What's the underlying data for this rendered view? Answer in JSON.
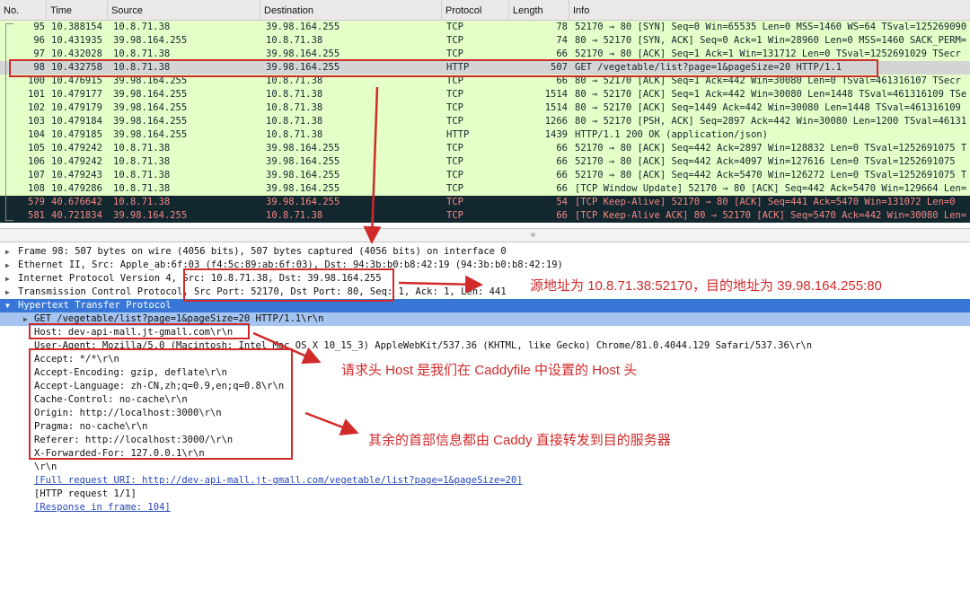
{
  "columns": [
    "No.",
    "Time",
    "Source",
    "Destination",
    "Protocol",
    "Length",
    "Info"
  ],
  "packets": [
    {
      "no": "95",
      "time": "10.388154",
      "src": "10.8.71.38",
      "dst": "39.98.164.255",
      "proto": "TCP",
      "len": "78",
      "info": "52170 → 80 [SYN] Seq=0 Win=65535 Len=0 MSS=1460 WS=64 TSval=125269090",
      "style": "tcp"
    },
    {
      "no": "96",
      "time": "10.431935",
      "src": "39.98.164.255",
      "dst": "10.8.71.38",
      "proto": "TCP",
      "len": "74",
      "info": "80 → 52170 [SYN, ACK] Seq=0 Ack=1 Win=28960 Len=0 MSS=1460 SACK_PERM=",
      "style": "tcp"
    },
    {
      "no": "97",
      "time": "10.432028",
      "src": "10.8.71.38",
      "dst": "39.98.164.255",
      "proto": "TCP",
      "len": "66",
      "info": "52170 → 80 [ACK] Seq=1 Ack=1 Win=131712 Len=0 TSval=1252691029 TSecr",
      "style": "tcp"
    },
    {
      "no": "98",
      "time": "10.432758",
      "src": "10.8.71.38",
      "dst": "39.98.164.255",
      "proto": "HTTP",
      "len": "507",
      "info": "GET /vegetable/list?page=1&pageSize=20 HTTP/1.1",
      "style": "sel"
    },
    {
      "no": "100",
      "time": "10.476915",
      "src": "39.98.164.255",
      "dst": "10.8.71.38",
      "proto": "TCP",
      "len": "66",
      "info": "80 → 52170 [ACK] Seq=1 Ack=442 Win=30080 Len=0 TSval=461316107 TSecr",
      "style": "tcp"
    },
    {
      "no": "101",
      "time": "10.479177",
      "src": "39.98.164.255",
      "dst": "10.8.71.38",
      "proto": "TCP",
      "len": "1514",
      "info": "80 → 52170 [ACK] Seq=1 Ack=442 Win=30080 Len=1448 TSval=461316109 TSe",
      "style": "tcp"
    },
    {
      "no": "102",
      "time": "10.479179",
      "src": "39.98.164.255",
      "dst": "10.8.71.38",
      "proto": "TCP",
      "len": "1514",
      "info": "80 → 52170 [ACK] Seq=1449 Ack=442 Win=30080 Len=1448 TSval=461316109",
      "style": "tcp"
    },
    {
      "no": "103",
      "time": "10.479184",
      "src": "39.98.164.255",
      "dst": "10.8.71.38",
      "proto": "TCP",
      "len": "1266",
      "info": "80 → 52170 [PSH, ACK] Seq=2897 Ack=442 Win=30080 Len=1200 TSval=46131",
      "style": "tcp"
    },
    {
      "no": "104",
      "time": "10.479185",
      "src": "39.98.164.255",
      "dst": "10.8.71.38",
      "proto": "HTTP",
      "len": "1439",
      "info": "HTTP/1.1 200 OK  (application/json)",
      "style": "http"
    },
    {
      "no": "105",
      "time": "10.479242",
      "src": "10.8.71.38",
      "dst": "39.98.164.255",
      "proto": "TCP",
      "len": "66",
      "info": "52170 → 80 [ACK] Seq=442 Ack=2897 Win=128832 Len=0 TSval=1252691075 T",
      "style": "tcp"
    },
    {
      "no": "106",
      "time": "10.479242",
      "src": "10.8.71.38",
      "dst": "39.98.164.255",
      "proto": "TCP",
      "len": "66",
      "info": "52170 → 80 [ACK] Seq=442 Ack=4097 Win=127616 Len=0 TSval=1252691075",
      "style": "tcp"
    },
    {
      "no": "107",
      "time": "10.479243",
      "src": "10.8.71.38",
      "dst": "39.98.164.255",
      "proto": "TCP",
      "len": "66",
      "info": "52170 → 80 [ACK] Seq=442 Ack=5470 Win=126272 Len=0 TSval=1252691075 T",
      "style": "tcp"
    },
    {
      "no": "108",
      "time": "10.479286",
      "src": "10.8.71.38",
      "dst": "39.98.164.255",
      "proto": "TCP",
      "len": "66",
      "info": "[TCP Window Update] 52170 → 80 [ACK] Seq=442 Ack=5470 Win=129664 Len=",
      "style": "tcp"
    },
    {
      "no": "579",
      "time": "40.676642",
      "src": "10.8.71.38",
      "dst": "39.98.164.255",
      "proto": "TCP",
      "len": "54",
      "info": "[TCP Keep-Alive] 52170 → 80 [ACK] Seq=441 Ack=5470 Win=131072 Len=0",
      "style": "ka"
    },
    {
      "no": "581",
      "time": "40.721834",
      "src": "39.98.164.255",
      "dst": "10.8.71.38",
      "proto": "TCP",
      "len": "66",
      "info": "[TCP Keep-Alive ACK] 80 → 52170 [ACK] Seq=5470 Ack=442 Win=30080 Len=",
      "style": "ka"
    }
  ],
  "details": [
    {
      "indent": 0,
      "tri": "▶",
      "text": "Frame 98: 507 bytes on wire (4056 bits), 507 bytes captured (4056 bits) on interface 0",
      "style": ""
    },
    {
      "indent": 0,
      "tri": "▶",
      "text": "Ethernet II, Src: Apple_ab:6f:03 (f4:5c:89:ab:6f:03), Dst: 94:3b:b0:b8:42:19 (94:3b:b0:b8:42:19)",
      "style": ""
    },
    {
      "indent": 0,
      "tri": "▶",
      "text": "Internet Protocol Version 4, Src: 10.8.71.38, Dst: 39.98.164.255",
      "style": ""
    },
    {
      "indent": 0,
      "tri": "▶",
      "text": "Transmission Control Protocol, Src Port: 52170, Dst Port: 80, Seq: 1, Ack: 1, Len: 441",
      "style": ""
    },
    {
      "indent": 0,
      "tri": "▼",
      "text": "Hypertext Transfer Protocol",
      "style": "hl"
    },
    {
      "indent": 1,
      "tri": "▶",
      "text": "GET /vegetable/list?page=1&pageSize=20 HTTP/1.1\\r\\n",
      "style": "sub"
    },
    {
      "indent": 1,
      "tri": "",
      "text": "Host: dev-api-mall.jt-gmall.com\\r\\n",
      "style": ""
    },
    {
      "indent": 1,
      "tri": "",
      "text": "User-Agent: Mozilla/5.0 (Macintosh; Intel Mac OS X 10_15_3) AppleWebKit/537.36 (KHTML, like Gecko) Chrome/81.0.4044.129 Safari/537.36\\r\\n",
      "style": ""
    },
    {
      "indent": 1,
      "tri": "",
      "text": "Accept: */*\\r\\n",
      "style": ""
    },
    {
      "indent": 1,
      "tri": "",
      "text": "Accept-Encoding: gzip, deflate\\r\\n",
      "style": ""
    },
    {
      "indent": 1,
      "tri": "",
      "text": "Accept-Language: zh-CN,zh;q=0.9,en;q=0.8\\r\\n",
      "style": ""
    },
    {
      "indent": 1,
      "tri": "",
      "text": "Cache-Control: no-cache\\r\\n",
      "style": ""
    },
    {
      "indent": 1,
      "tri": "",
      "text": "Origin: http://localhost:3000\\r\\n",
      "style": ""
    },
    {
      "indent": 1,
      "tri": "",
      "text": "Pragma: no-cache\\r\\n",
      "style": ""
    },
    {
      "indent": 1,
      "tri": "",
      "text": "Referer: http://localhost:3000/\\r\\n",
      "style": ""
    },
    {
      "indent": 1,
      "tri": "",
      "text": "X-Forwarded-For: 127.0.0.1\\r\\n",
      "style": ""
    },
    {
      "indent": 1,
      "tri": "",
      "text": "\\r\\n",
      "style": ""
    },
    {
      "indent": 1,
      "tri": "",
      "text": "[Full request URI: http://dev-api-mall.jt-gmall.com/vegetable/list?page=1&pageSize=20]",
      "style": "link"
    },
    {
      "indent": 1,
      "tri": "",
      "text": "[HTTP request 1/1]",
      "style": ""
    },
    {
      "indent": 1,
      "tri": "",
      "text": "[Response in frame: 104]",
      "style": "link"
    }
  ],
  "annotations": {
    "addr_note": "源地址为 10.8.71.38:52170，目的地址为 39.98.164.255:80",
    "host_note": "请求头 Host 是我们在 Caddyfile 中设置的 Host 头",
    "rest_note": "其余的首部信息都由 Caddy 直接转发到目的服务器",
    "color": "#d12a2a"
  },
  "colors": {
    "tcp_row": "#e4ffc7",
    "selected_row": "#d4d4d4",
    "keepalive_row": "#12272e",
    "keepalive_text": "#f78787",
    "selected_detail": "#3877d7"
  }
}
